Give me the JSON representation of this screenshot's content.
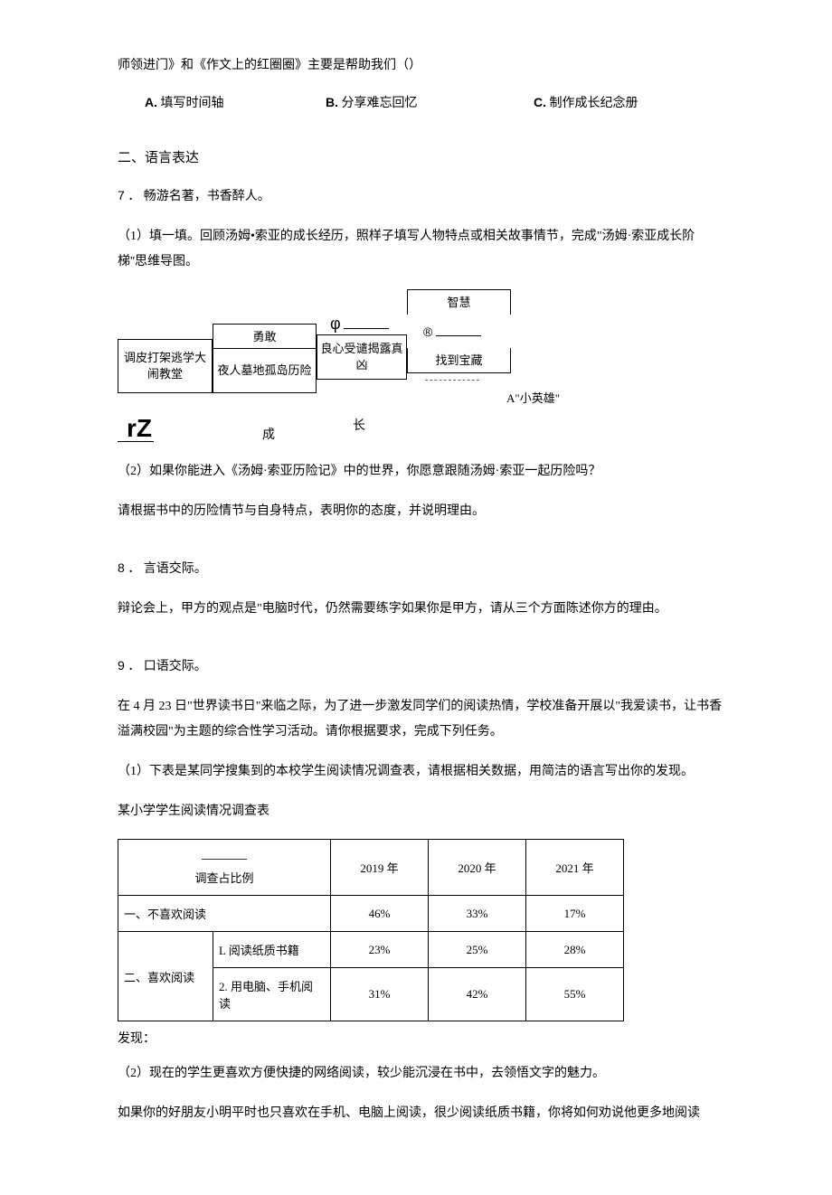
{
  "top_line": "师领进门》和《作文上的红圈圈》主要是帮助我们（）",
  "options": {
    "a_label": "A.",
    "a_text": "填写时间轴",
    "b_label": "B.",
    "b_text": "分享难忘回忆",
    "c_label": "C.",
    "c_text": "制作成长纪念册"
  },
  "section2": "二、语言表达",
  "q7": {
    "num": "7",
    "dot": "．",
    "title": "畅游名著，书香醉人。",
    "p1": "（1）填一填。回顾汤姆•索亚的成长经历，照样子填写人物特点或相关故事情节，完成\"汤姆·索亚成长阶梯''思维导图。",
    "diagram": {
      "box1a": "调皮打架逃学大闹教堂",
      "box2a": "勇敢",
      "box2b": "夜人墓地孤岛历险",
      "phi": "φ",
      "box3b": "良心受谴揭露真凶",
      "reg": "®",
      "box4a": "智慧",
      "box4b": "找到宝藏",
      "hero": "A\"小英雄\"",
      "z": "rZ",
      "cheng": "成",
      "zhang": "长"
    },
    "p2": "（2）如果你能进入《汤姆·索亚历险记》中的世界，你愿意跟随汤姆·索亚一起历险吗？",
    "p3": "请根据书中的历险情节与自身特点，表明你的态度，并说明理由。"
  },
  "q8": {
    "num": "8",
    "dot": "．",
    "title": "言语交际。",
    "body": "辩论会上，甲方的观点是\"电脑时代，仍然需要练字如果你是甲方，请从三个方面陈述你方的理由。"
  },
  "q9": {
    "num": "9",
    "dot": "．",
    "title": "口语交际。",
    "p1": "在 4 月 23 日\"世界读书日\"来临之际，为了进一步激发同学们的阅读热情，学校准备开展以\"我爱读书，让书香溢满校园\"为主题的综合性学习活动。请你根据要求，完成下列任务。",
    "p2": "（1）下表是某同学搜集到的本校学生阅读情况调查表，请根据相关数据，用简洁的语言写出你的发现。",
    "p3": "某小学学生阅读情况调查表",
    "table_header_cell": "调查占比例",
    "row1_label": "一、不喜欢阅读",
    "row2_label": "二、喜欢阅读",
    "row2a": "L 阅读纸质书籍",
    "row2b": "2. 用电脑、手机阅读",
    "found": "发现：",
    "p4": "（2）现在的学生更喜欢方便快捷的网络阅读，较少能沉浸在书中，去领悟文字的魅力。",
    "p5": "如果你的好朋友小明平时也只喜欢在手机、电脑上阅读，很少阅读纸质书籍，你将如何劝说他更多地阅读",
    "chart_data": {
      "type": "table",
      "title": "某小学学生阅读情况调查表",
      "columns": [
        "2019 年",
        "2020 年",
        "2021 年"
      ],
      "rows": [
        {
          "category": "一、不喜欢阅读",
          "sub": "",
          "values": [
            "46%",
            "33%",
            "17%"
          ]
        },
        {
          "category": "二、喜欢阅读",
          "sub": "L 阅读纸质书籍",
          "values": [
            "23%",
            "25%",
            "28%"
          ]
        },
        {
          "category": "二、喜欢阅读",
          "sub": "2. 用电脑、手机阅读",
          "values": [
            "31%",
            "42%",
            "55%"
          ]
        }
      ]
    }
  }
}
